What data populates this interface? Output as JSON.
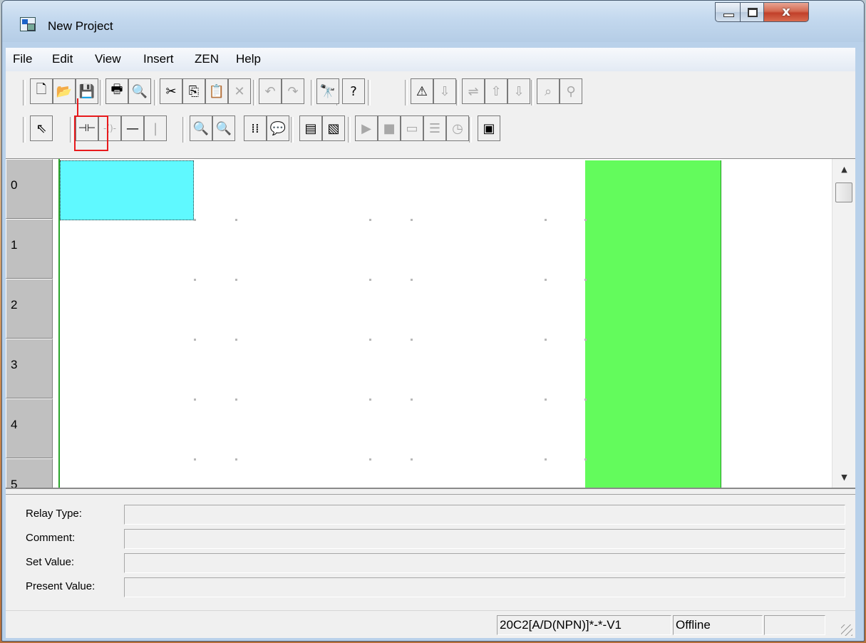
{
  "window": {
    "title": "New Project",
    "close_glyph": "x"
  },
  "menu": [
    "File",
    "Edit",
    "View",
    "Insert",
    "ZEN",
    "Help"
  ],
  "toolbar1": [
    {
      "name": "new-file-icon",
      "glyph": "🗋",
      "enabled": true
    },
    {
      "name": "open-folder-icon",
      "glyph": "📂",
      "enabled": true
    },
    {
      "name": "save-icon",
      "glyph": "💾",
      "enabled": true
    },
    {
      "name": "print-icon",
      "glyph": "🖶",
      "enabled": true
    },
    {
      "name": "print-preview-icon",
      "glyph": "🔍",
      "enabled": true
    },
    {
      "name": "cut-icon",
      "glyph": "✂",
      "enabled": true
    },
    {
      "name": "copy-icon",
      "glyph": "⎘",
      "enabled": true
    },
    {
      "name": "paste-icon",
      "glyph": "📋",
      "enabled": false
    },
    {
      "name": "delete-icon",
      "glyph": "✕",
      "enabled": false
    },
    {
      "name": "undo-icon",
      "glyph": "↶",
      "enabled": false
    },
    {
      "name": "redo-icon",
      "glyph": "↷",
      "enabled": false
    },
    {
      "name": "find-icon",
      "glyph": "🔭",
      "enabled": true
    },
    {
      "name": "help-icon",
      "glyph": "?",
      "enabled": true
    },
    {
      "name": "warning-check-icon",
      "glyph": "⚠",
      "enabled": true
    },
    {
      "name": "transfer-icon",
      "glyph": "⇩",
      "enabled": false
    },
    {
      "name": "compare-icon",
      "glyph": "⇌",
      "enabled": false
    },
    {
      "name": "upload-icon",
      "glyph": "⇧",
      "enabled": false
    },
    {
      "name": "download-icon",
      "glyph": "⇩",
      "enabled": false
    },
    {
      "name": "inspect-icon",
      "glyph": "⌕",
      "enabled": false
    },
    {
      "name": "connect-icon",
      "glyph": "⚲",
      "enabled": false
    },
    {
      "name": "disconnect-icon",
      "glyph": "⚯",
      "enabled": false
    }
  ],
  "toolbar2": [
    {
      "name": "select-pointer-icon",
      "glyph": "⇖",
      "enabled": true
    },
    {
      "name": "contact-icon",
      "glyph": "⊣⊢",
      "enabled": true
    },
    {
      "name": "coil-icon",
      "glyph": "-()-",
      "enabled": false
    },
    {
      "name": "horizontal-line-icon",
      "glyph": "—",
      "enabled": true
    },
    {
      "name": "vertical-line-icon",
      "glyph": "|",
      "enabled": false
    },
    {
      "name": "zoom-out-icon",
      "glyph": "🔍",
      "enabled": true
    },
    {
      "name": "zoom-in-icon",
      "glyph": "🔍",
      "enabled": true
    },
    {
      "name": "grid-icon",
      "glyph": "⁞⁞",
      "enabled": true
    },
    {
      "name": "comment-icon",
      "glyph": "💬",
      "enabled": true
    },
    {
      "name": "ladder-view-icon",
      "glyph": "▤",
      "enabled": true
    },
    {
      "name": "parameter-view-icon",
      "glyph": "▧",
      "enabled": true
    },
    {
      "name": "run-icon",
      "glyph": "▶",
      "enabled": false
    },
    {
      "name": "stop-icon",
      "glyph": "■",
      "enabled": false
    },
    {
      "name": "monitor-icon",
      "glyph": "▭",
      "enabled": false
    },
    {
      "name": "list-icon",
      "glyph": "☰",
      "enabled": false
    },
    {
      "name": "clock-icon",
      "glyph": "◷",
      "enabled": false
    },
    {
      "name": "simulate-icon",
      "glyph": "▣",
      "enabled": true
    }
  ],
  "ladder": {
    "row_numbers": [
      "0",
      "1",
      "2",
      "3",
      "4",
      "5"
    ],
    "colors": {
      "cursor": "#5ff9ff",
      "output_column": "#63fb5c",
      "rail": "#2aa52a"
    }
  },
  "properties": [
    {
      "label": "Relay Type:",
      "value": ""
    },
    {
      "label": "Comment:",
      "value": ""
    },
    {
      "label": "Set Value:",
      "value": ""
    },
    {
      "label": "Present Value:",
      "value": ""
    }
  ],
  "status": {
    "device": "20C2[A/D(NPN)]*-*-V1",
    "connection": "Offline",
    "extra": ""
  },
  "annotation": {
    "color": "#e8191c"
  }
}
